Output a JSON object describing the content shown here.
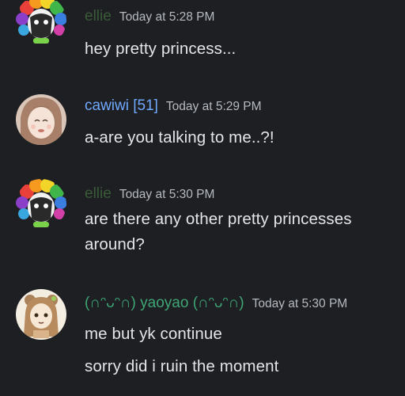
{
  "colors": {
    "background": "#1e1f22",
    "text": "#e3e5e8",
    "timestamp": "#b5bac1",
    "ellie": "#3a5a3a",
    "cawiwi": "#6fa8ff",
    "yaoyao": "#3fa575"
  },
  "messages": [
    {
      "username": "ellie",
      "timestamp": "Today at 5:28 PM",
      "lines": [
        "hey pretty princess..."
      ],
      "avatar": "rainbow-clown-avatar"
    },
    {
      "username": "cawiwi [51]",
      "timestamp": "Today at 5:29 PM",
      "lines": [
        "a-are you talking to me..?!"
      ],
      "avatar": "anime-girl-avatar"
    },
    {
      "username": "ellie",
      "timestamp": "Today at 5:30 PM",
      "lines": [
        "are there any other pretty princesses",
        "around?"
      ],
      "avatar": "rainbow-clown-avatar"
    },
    {
      "username": "(∩ᵔᴗᵔ∩) yaoyao (∩ᵔᴗᵔ∩)",
      "timestamp": "Today at 5:30 PM",
      "lines": [
        "me but yk continue",
        "sorry did i ruin the moment"
      ],
      "avatar": "bear-girl-avatar"
    }
  ]
}
